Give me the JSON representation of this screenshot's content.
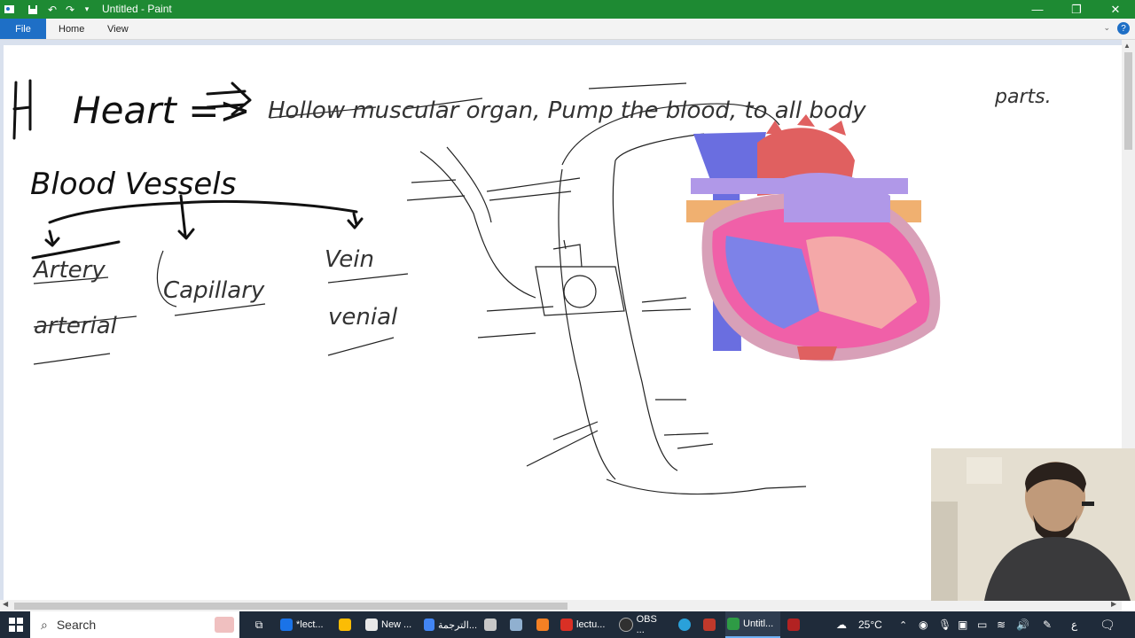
{
  "window": {
    "title": "Untitled - Paint",
    "minimize": "—",
    "restore": "❐",
    "close": "✕"
  },
  "quick_access": {
    "icons": [
      "paint-app-icon",
      "save-icon",
      "undo-icon",
      "redo-icon",
      "customize-icon"
    ]
  },
  "menu": {
    "file": "File",
    "home": "Home",
    "view": "View",
    "help": "?",
    "collapse": "⌄"
  },
  "drawing": {
    "heart_title": "Heart =>",
    "heart_def": "Hollow muscular organ, Pump the blood, to all body",
    "heart_def2": "parts.",
    "blood_vessels": "Blood Vessels",
    "artery": "Artery",
    "arterial": "arterial",
    "capillary": "Capillary",
    "vein": "Vein",
    "venial": "venial"
  },
  "taskbar": {
    "search": "Search",
    "apps": [
      {
        "label": "*lect...",
        "color": "#1a73e8"
      },
      {
        "label": "",
        "color": "#fbbc05"
      },
      {
        "label": "New ...",
        "color": "#e8e8e8"
      },
      {
        "label": "الترجمة...",
        "color": "#4285f4"
      },
      {
        "label": "",
        "color": "#c8c8c8"
      },
      {
        "label": "",
        "color": "#90b0d0"
      },
      {
        "label": "",
        "color": "#f48024"
      },
      {
        "label": "lectu...",
        "color": "#d93025"
      },
      {
        "label": "OBS ...",
        "color": "#303030"
      },
      {
        "label": "",
        "color": "#2aa1da"
      },
      {
        "label": "",
        "color": "#c0392b"
      },
      {
        "label": "Untitl...",
        "color": "#2e9b45"
      },
      {
        "label": "",
        "color": "#b22222"
      }
    ],
    "weather": "25°C",
    "lang": "ع"
  }
}
